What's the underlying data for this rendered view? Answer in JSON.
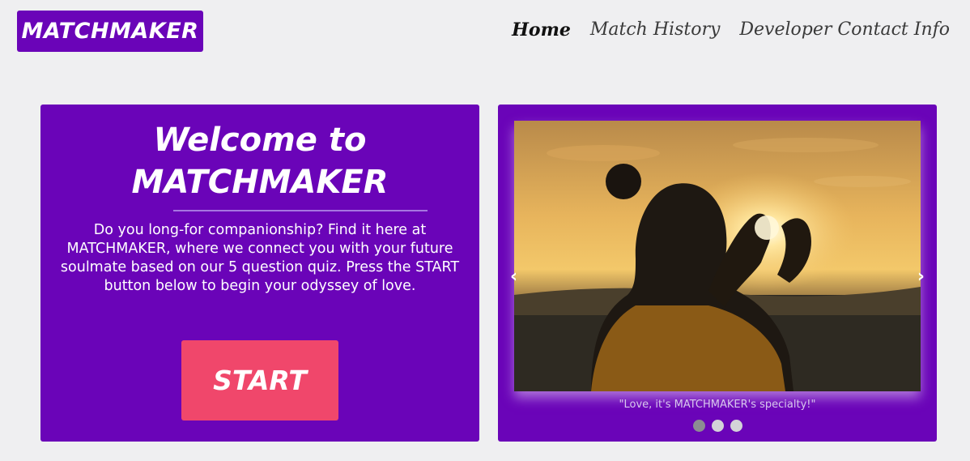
{
  "brand": {
    "label": "MATCHMAKER"
  },
  "nav": {
    "items": [
      {
        "label": "Home",
        "active": true
      },
      {
        "label": "Match History",
        "active": false
      },
      {
        "label": "Developer Contact Info",
        "active": false
      }
    ]
  },
  "welcome": {
    "title_line1": "Welcome to",
    "title_line2": "MATCHMAKER",
    "description": "Do you long-for companionship? Find it here at MATCHMAKER, where we connect you with your future soulmate based on our 5 question quiz. Press the START button below to begin your odyssey of love.",
    "start_label": "START"
  },
  "carousel": {
    "prev_glyph": "‹",
    "next_glyph": "›",
    "caption": "\"Love, it's MATCHMAKER's specialty!\"",
    "slide_count": 3,
    "active_index": 0
  },
  "colors": {
    "brand_purple": "#6a04b8",
    "start_pink": "#f0476b",
    "page_bg": "#efeff1"
  }
}
